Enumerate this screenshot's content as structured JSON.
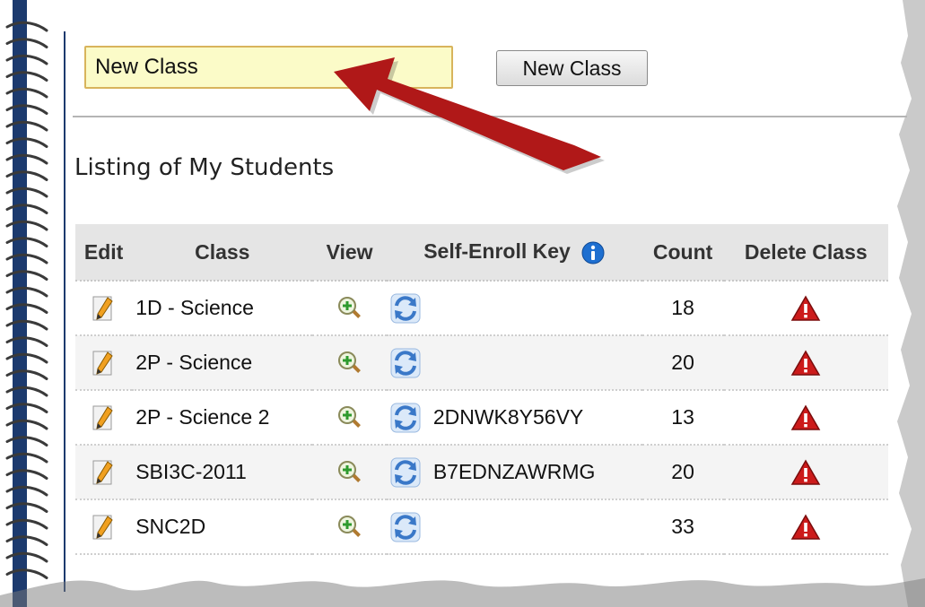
{
  "new_class": {
    "input_value": "New Class",
    "button_label": "New Class"
  },
  "section_title": "Listing of My Students",
  "table": {
    "headers": {
      "edit": "Edit",
      "class": "Class",
      "view": "View",
      "key": "Self-Enroll Key",
      "count": "Count",
      "delete": "Delete Class"
    },
    "rows": [
      {
        "class": "1D - Science",
        "key": "",
        "count": "18"
      },
      {
        "class": "2P - Science",
        "key": "",
        "count": "20"
      },
      {
        "class": "2P - Science 2",
        "key": "2DNWK8Y56VY",
        "count": "13"
      },
      {
        "class": "SBI3C-2011",
        "key": "B7EDNZAWRMG",
        "count": "20"
      },
      {
        "class": "SNC2D",
        "key": "",
        "count": "33"
      }
    ]
  },
  "icons": {
    "edit": "pencil-icon",
    "view": "magnifier-plus-icon",
    "regenerate": "refresh-arrows-icon",
    "info": "info-icon",
    "delete": "warning-triangle-icon"
  },
  "colors": {
    "input_bg": "#fbfbc8",
    "arrow": "#b01818",
    "delete_icon": "#cc1b1b",
    "refresh_icon": "#3a78c8",
    "info_icon": "#1e6fd0",
    "binding": "#1c3a6e"
  }
}
